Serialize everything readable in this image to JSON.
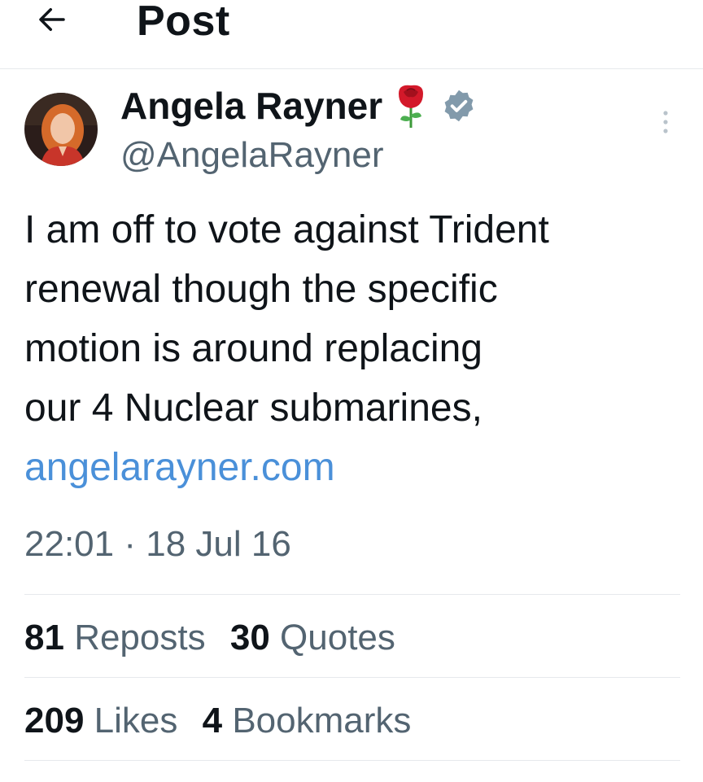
{
  "header": {
    "title": "Post",
    "back_icon": "arrow-left-icon"
  },
  "author": {
    "display_name": "Angela Rayner",
    "handle": "@AngelaRayner",
    "emoji_icon": "rose-icon",
    "verified_icon": "verified-badge-icon"
  },
  "post": {
    "text_lines": [
      "I am off to vote against Trident",
      "renewal though the specific",
      "motion is around replacing",
      "our 4 Nuclear submarines,"
    ],
    "link": "angelarayner.com",
    "time": "22:01",
    "separator": "·",
    "date": "18 Jul 16"
  },
  "stats": {
    "reposts": {
      "count": "81",
      "label": "Reposts"
    },
    "quotes": {
      "count": "30",
      "label": "Quotes"
    },
    "likes": {
      "count": "209",
      "label": "Likes"
    },
    "bookmarks": {
      "count": "4",
      "label": "Bookmarks"
    }
  },
  "colors": {
    "text": "#0f1419",
    "secondary": "#536471",
    "link": "#4a90d9",
    "divider": "#e6e9ec",
    "verified_badge": "#829aab",
    "rose": "#d3192a"
  }
}
